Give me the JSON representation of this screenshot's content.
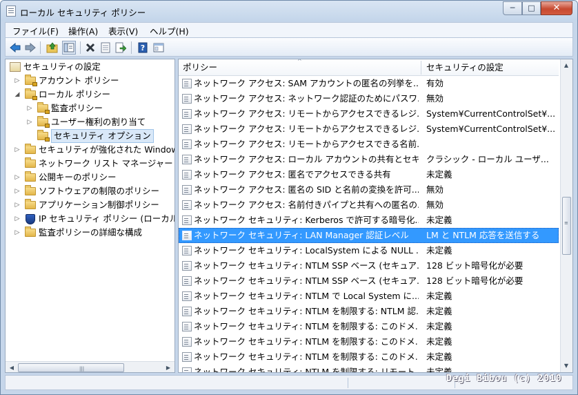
{
  "window": {
    "title": "ローカル セキュリティ ポリシー",
    "controls": {
      "minimize": "─",
      "maximize": "□",
      "close": "✕"
    }
  },
  "menu": {
    "items": [
      "ファイル(F)",
      "操作(A)",
      "表示(V)",
      "ヘルプ(H)"
    ]
  },
  "toolbar": {
    "icons": [
      "back-icon",
      "forward-icon",
      "up-folder-icon",
      "show-hide-tree-icon",
      "delete-icon",
      "properties-icon",
      "export-list-icon",
      "help-icon",
      "mmc-view-icon"
    ]
  },
  "tree": {
    "root": "セキュリティの設定",
    "items": [
      {
        "label": "アカウント ポリシー",
        "level": 1,
        "expander": "right",
        "icon": "folder-lock"
      },
      {
        "label": "ローカル ポリシー",
        "level": 1,
        "expander": "down",
        "icon": "folder-lock"
      },
      {
        "label": "監査ポリシー",
        "level": 2,
        "expander": "right",
        "icon": "folder-lock"
      },
      {
        "label": "ユーザー権利の割り当て",
        "level": 2,
        "expander": "right",
        "icon": "folder-lock"
      },
      {
        "label": "セキュリティ オプション",
        "level": 2,
        "expander": "none",
        "icon": "folder-lock",
        "selected": true
      },
      {
        "label": "セキュリティが強化された Windows",
        "level": 1,
        "expander": "right",
        "icon": "folder"
      },
      {
        "label": "ネットワーク リスト マネージャー ポ",
        "level": 1,
        "expander": "none",
        "icon": "folder"
      },
      {
        "label": "公開キーのポリシー",
        "level": 1,
        "expander": "right",
        "icon": "folder"
      },
      {
        "label": "ソフトウェアの制限のポリシー",
        "level": 1,
        "expander": "right",
        "icon": "folder"
      },
      {
        "label": "アプリケーション制御ポリシー",
        "level": 1,
        "expander": "right",
        "icon": "folder"
      },
      {
        "label": "IP セキュリティ ポリシー (ローカル",
        "level": 1,
        "expander": "right",
        "icon": "shield"
      },
      {
        "label": "監査ポリシーの詳細な構成",
        "level": 1,
        "expander": "right",
        "icon": "folder"
      }
    ]
  },
  "list": {
    "columns": [
      "ポリシー",
      "セキュリティの設定"
    ],
    "sort_glyph": "^",
    "rows": [
      {
        "policy": "ネットワーク アクセス: SAM アカウントの匿名の列挙を...",
        "setting": "有効"
      },
      {
        "policy": "ネットワーク アクセス: ネットワーク認証のためにパスワ...",
        "setting": "無効"
      },
      {
        "policy": "ネットワーク アクセス: リモートからアクセスできるレジ...",
        "setting": "System¥CurrentControlSet¥..."
      },
      {
        "policy": "ネットワーク アクセス: リモートからアクセスできるレジ...",
        "setting": "System¥CurrentControlSet¥..."
      },
      {
        "policy": "ネットワーク アクセス: リモートからアクセスできる名前...",
        "setting": ""
      },
      {
        "policy": "ネットワーク アクセス: ローカル アカウントの共有とセキ...",
        "setting": "クラシック - ローカル ユーザ..."
      },
      {
        "policy": "ネットワーク アクセス: 匿名でアクセスできる共有",
        "setting": "未定義"
      },
      {
        "policy": "ネットワーク アクセス: 匿名の SID と名前の変換を許可...",
        "setting": "無効"
      },
      {
        "policy": "ネットワーク アクセス: 名前付きパイプと共有への匿名の...",
        "setting": "無効"
      },
      {
        "policy": "ネットワーク セキュリティ: Kerberos で許可する暗号化...",
        "setting": "未定義"
      },
      {
        "policy": "ネットワーク セキュリティ: LAN Manager 認証レベル",
        "setting": "LM と NTLM 応答を送信する",
        "selected": true
      },
      {
        "policy": "ネットワーク セキュリティ: LocalSystem による NULL ...",
        "setting": "未定義"
      },
      {
        "policy": "ネットワーク セキュリティ: NTLM SSP ベース (セキュア...",
        "setting": "128 ビット暗号化が必要"
      },
      {
        "policy": "ネットワーク セキュリティ: NTLM SSP ベース (セキュア...",
        "setting": "128 ビット暗号化が必要"
      },
      {
        "policy": "ネットワーク セキュリティ: NTLM で Local System に...",
        "setting": "未定義"
      },
      {
        "policy": "ネットワーク セキュリティ: NTLM を制限する: NTLM 認...",
        "setting": "未定義"
      },
      {
        "policy": "ネットワーク セキュリティ: NTLM を制限する: このドメ...",
        "setting": "未定義"
      },
      {
        "policy": "ネットワーク セキュリティ: NTLM を制限する: このドメ...",
        "setting": "未定義"
      },
      {
        "policy": "ネットワーク セキュリティ: NTLM を制限する: このドメ...",
        "setting": "未定義"
      },
      {
        "policy": "ネットワーク セキュリティ: NTLM を制限する: リモート...",
        "setting": "未定義"
      }
    ]
  },
  "scroll": {
    "h_left": "◀",
    "h_right": "▶",
    "h_grip": "|||",
    "v_up": "▲",
    "v_down": "▼",
    "v_grip": "≡"
  },
  "watermark": "Degi Bibou (c) 2010",
  "colors": {
    "selection": "#3399ff",
    "frame": "#c6d6ea",
    "close_button": "#c74a30"
  }
}
